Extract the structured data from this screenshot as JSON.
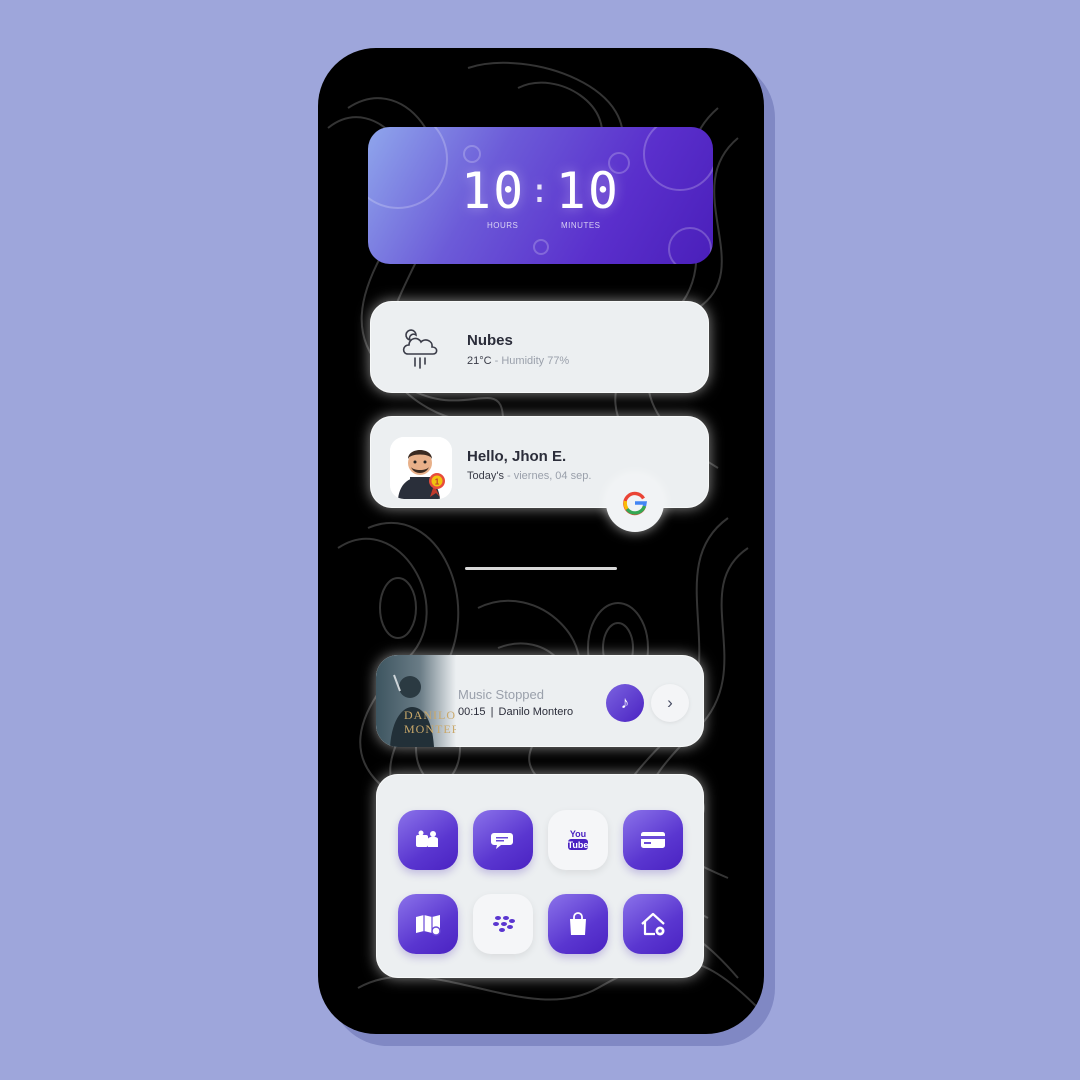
{
  "clock": {
    "hours": "10",
    "minutes": "10",
    "hours_label": "HOURS",
    "minutes_label": "MINUTES"
  },
  "weather": {
    "icon": "cloud-rain-moon-icon",
    "condition": "Nubes",
    "temperature": "21°C",
    "separator": " - ",
    "humidity": "Humidity 77%"
  },
  "greeting": {
    "avatar": "avatar",
    "title": "Hello, Jhon E.",
    "today_label": "Today's",
    "separator": " - ",
    "date": "viernes, 04 sep."
  },
  "google_button": {
    "icon": "google-g-icon"
  },
  "music": {
    "status": "Music Stopped",
    "time": "00:15",
    "separator": "|",
    "artist": "Danilo Montero",
    "album_art_text": "DANILO\nMONTERO",
    "play_icon": "music-note-icon",
    "next_icon": "chevron-right-icon"
  },
  "apps": [
    {
      "name": "app-teams",
      "icon": "people-chat-icon"
    },
    {
      "name": "app-messages",
      "icon": "chat-bubbles-icon"
    },
    {
      "name": "app-youtube",
      "icon": "youtube-icon",
      "label": "You Tube"
    },
    {
      "name": "app-wallet",
      "icon": "credit-card-icon"
    },
    {
      "name": "app-maps",
      "icon": "map-book-icon"
    },
    {
      "name": "app-blackberry",
      "icon": "blackberry-icon"
    },
    {
      "name": "app-store",
      "icon": "shopping-bag-icon"
    },
    {
      "name": "app-home",
      "icon": "home-settings-icon"
    }
  ],
  "colors": {
    "background": "#9ea6db",
    "accent": "#5a36d0",
    "card": "#eceff1",
    "google_blue": "#4285f4",
    "google_red": "#ea4335",
    "google_yellow": "#fbbc05",
    "google_green": "#34a853"
  }
}
